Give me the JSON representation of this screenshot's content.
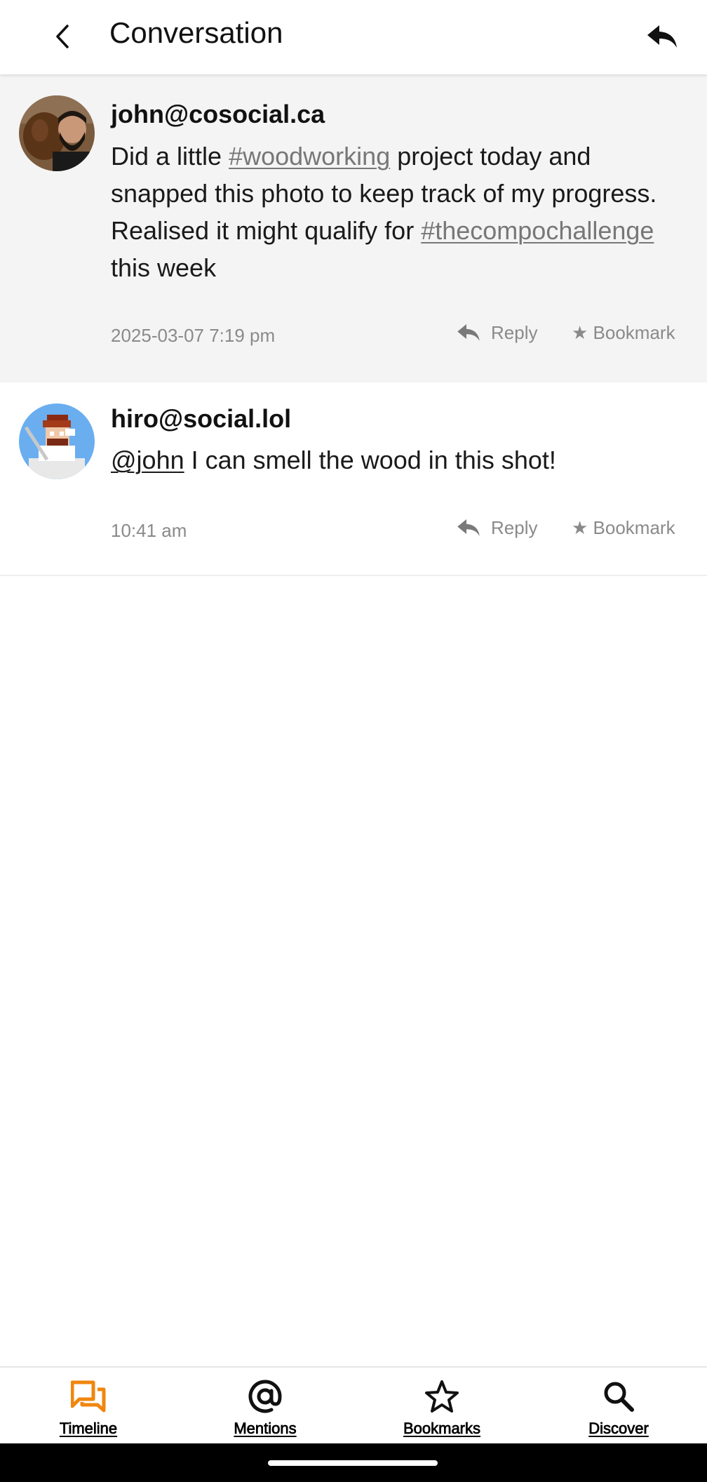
{
  "header": {
    "title": "Conversation",
    "back_icon": "chevron-left-icon",
    "reply_icon": "reply-icon"
  },
  "posts": [
    {
      "author": "john@cosocial.ca",
      "avatar": "photo of bearded man holding a brown dog",
      "content": {
        "t1": "Did a little ",
        "tag1": "#woodworking",
        "t2": " project today and snapped this photo to keep track of my progress. Realised it might qualify for ",
        "tag2": "#thecompochallenge",
        "t3": " this week"
      },
      "timestamp": "2025-03-07 7:19 pm",
      "reply_label": "Reply",
      "bookmark_label": "★ Bookmark",
      "highlighted": true
    },
    {
      "author": "hiro@social.lol",
      "avatar": "pixel-art avatar of a chef",
      "content": {
        "mention": "@john",
        "t1": " I can smell the wood in this shot!"
      },
      "timestamp": "10:41 am",
      "reply_label": "Reply",
      "bookmark_label": "★ Bookmark",
      "highlighted": false
    }
  ],
  "bottom_nav": [
    {
      "label": "Timeline",
      "icon": "chat-bubbles-icon",
      "active": true
    },
    {
      "label": "Mentions",
      "icon": "at-sign-icon",
      "active": false
    },
    {
      "label": "Bookmarks",
      "icon": "star-outline-icon",
      "active": false
    },
    {
      "label": "Discover",
      "icon": "search-icon",
      "active": false
    }
  ],
  "colors": {
    "accent": "#f0860e",
    "link": "#777777",
    "meta": "#8a8a8a",
    "highlight_bg": "#f4f4f4"
  }
}
